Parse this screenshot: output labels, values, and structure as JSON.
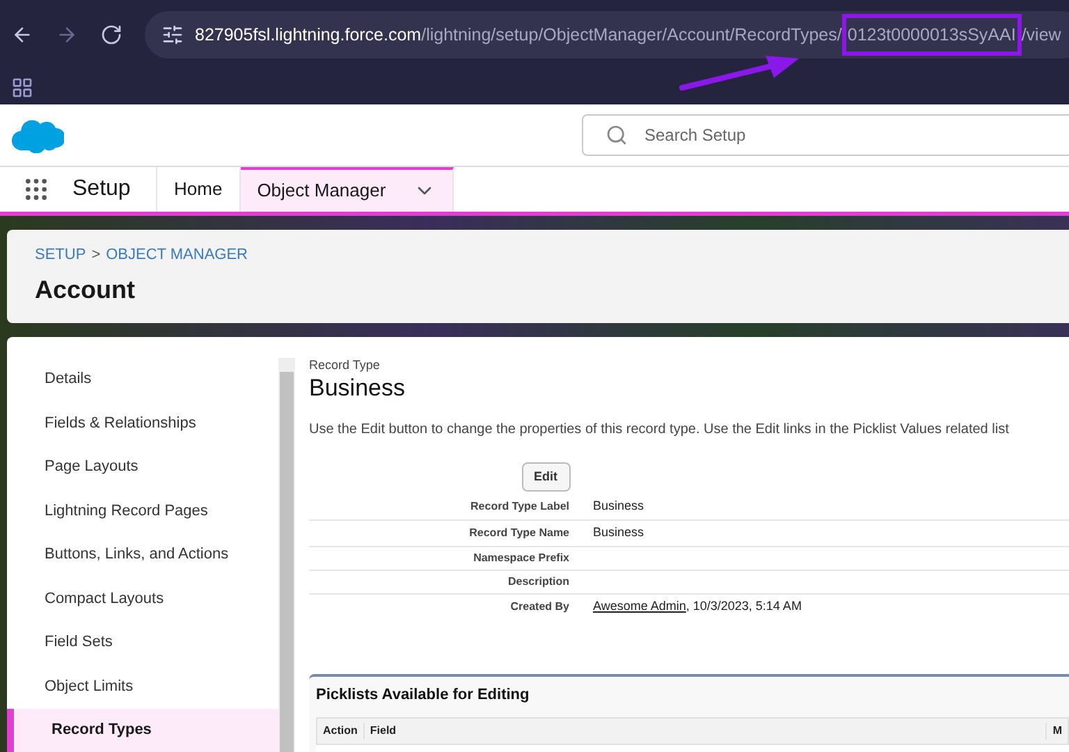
{
  "browser": {
    "url": {
      "host": "827905fsl.lightning.force.com",
      "path": "/lightning/setup/ObjectManager/Account/RecordTypes/",
      "highlighted": "0123t0000013sSyAAI",
      "tail": "/view"
    }
  },
  "header": {
    "search": {
      "placeholder": "Search Setup"
    }
  },
  "nav": {
    "app_name": "Setup",
    "tabs": [
      {
        "label": "Home",
        "selected": false,
        "menu": false
      },
      {
        "label": "Object Manager",
        "selected": true,
        "menu": true
      }
    ]
  },
  "page_header": {
    "breadcrumbs": [
      {
        "label": "SETUP"
      },
      {
        "label": "OBJECT MANAGER"
      }
    ],
    "separator": ">",
    "title": "Account"
  },
  "sidebar": {
    "items": [
      {
        "label": "Details",
        "selected": false
      },
      {
        "label": "Fields & Relationships",
        "selected": false
      },
      {
        "label": "Page Layouts",
        "selected": false
      },
      {
        "label": "Lightning Record Pages",
        "selected": false
      },
      {
        "label": "Buttons, Links, and Actions",
        "selected": false
      },
      {
        "label": "Compact Layouts",
        "selected": false
      },
      {
        "label": "Field Sets",
        "selected": false
      },
      {
        "label": "Object Limits",
        "selected": false
      },
      {
        "label": "Record Types",
        "selected": true
      }
    ]
  },
  "detail": {
    "eyebrow": "Record Type",
    "title": "Business",
    "description": "Use the Edit button to change the properties of this record type. Use the Edit links in the Picklist Values related list",
    "edit_button": "Edit",
    "fields": [
      {
        "label": "Record Type Label",
        "value": "Business"
      },
      {
        "label": "Record Type Name",
        "value": "Business"
      },
      {
        "label": "Namespace Prefix"
      },
      {
        "label": "Description"
      },
      {
        "label": "Created By",
        "link": "Awesome Admin",
        "value": ", 10/3/2023, 5:14 AM"
      }
    ]
  },
  "picklists": {
    "title": "Picklists Available for Editing",
    "columns": [
      "Action",
      "Field",
      "M"
    ]
  }
}
